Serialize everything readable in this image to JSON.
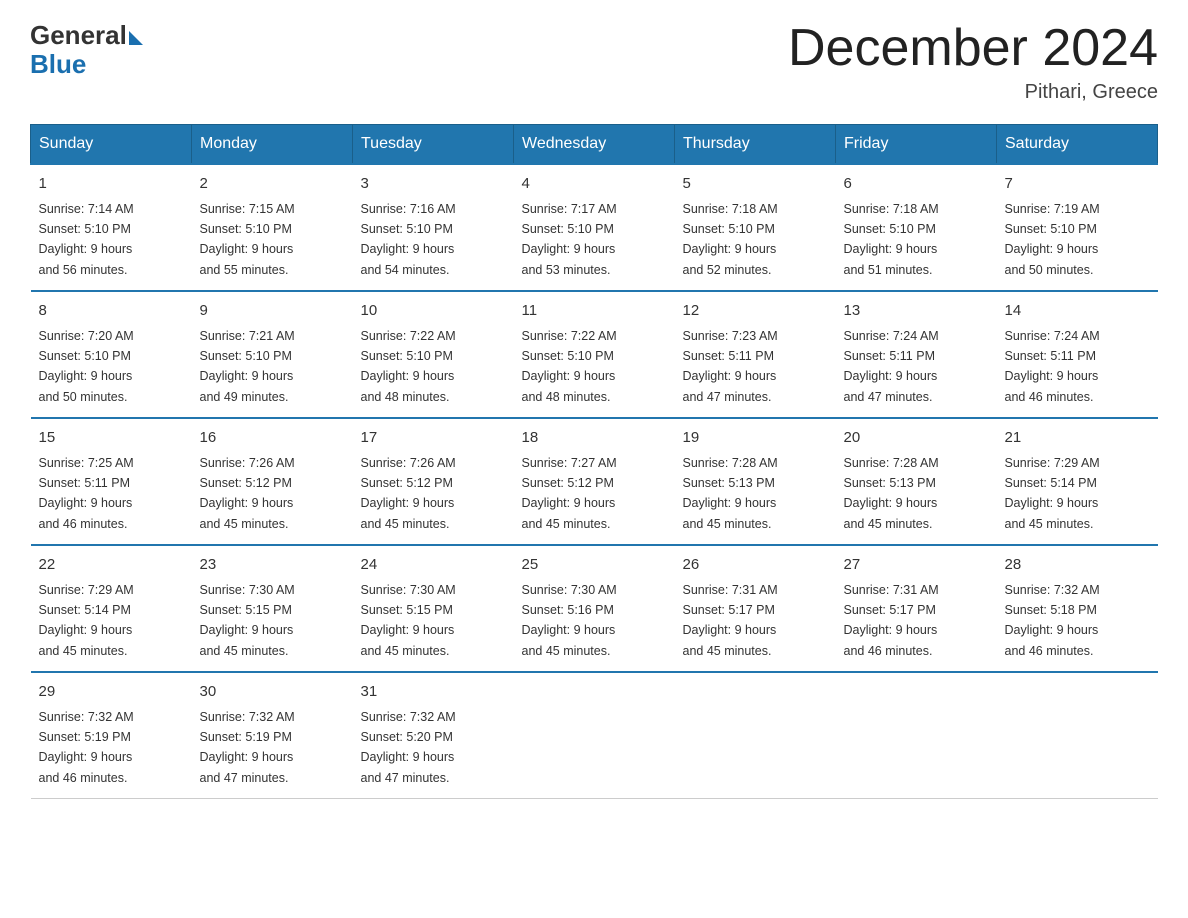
{
  "logo": {
    "general": "General",
    "blue": "Blue"
  },
  "header": {
    "title": "December 2024",
    "location": "Pithari, Greece"
  },
  "weekdays": [
    "Sunday",
    "Monday",
    "Tuesday",
    "Wednesday",
    "Thursday",
    "Friday",
    "Saturday"
  ],
  "weeks": [
    [
      {
        "day": "1",
        "sunrise": "7:14 AM",
        "sunset": "5:10 PM",
        "daylight": "9 hours and 56 minutes."
      },
      {
        "day": "2",
        "sunrise": "7:15 AM",
        "sunset": "5:10 PM",
        "daylight": "9 hours and 55 minutes."
      },
      {
        "day": "3",
        "sunrise": "7:16 AM",
        "sunset": "5:10 PM",
        "daylight": "9 hours and 54 minutes."
      },
      {
        "day": "4",
        "sunrise": "7:17 AM",
        "sunset": "5:10 PM",
        "daylight": "9 hours and 53 minutes."
      },
      {
        "day": "5",
        "sunrise": "7:18 AM",
        "sunset": "5:10 PM",
        "daylight": "9 hours and 52 minutes."
      },
      {
        "day": "6",
        "sunrise": "7:18 AM",
        "sunset": "5:10 PM",
        "daylight": "9 hours and 51 minutes."
      },
      {
        "day": "7",
        "sunrise": "7:19 AM",
        "sunset": "5:10 PM",
        "daylight": "9 hours and 50 minutes."
      }
    ],
    [
      {
        "day": "8",
        "sunrise": "7:20 AM",
        "sunset": "5:10 PM",
        "daylight": "9 hours and 50 minutes."
      },
      {
        "day": "9",
        "sunrise": "7:21 AM",
        "sunset": "5:10 PM",
        "daylight": "9 hours and 49 minutes."
      },
      {
        "day": "10",
        "sunrise": "7:22 AM",
        "sunset": "5:10 PM",
        "daylight": "9 hours and 48 minutes."
      },
      {
        "day": "11",
        "sunrise": "7:22 AM",
        "sunset": "5:10 PM",
        "daylight": "9 hours and 48 minutes."
      },
      {
        "day": "12",
        "sunrise": "7:23 AM",
        "sunset": "5:11 PM",
        "daylight": "9 hours and 47 minutes."
      },
      {
        "day": "13",
        "sunrise": "7:24 AM",
        "sunset": "5:11 PM",
        "daylight": "9 hours and 47 minutes."
      },
      {
        "day": "14",
        "sunrise": "7:24 AM",
        "sunset": "5:11 PM",
        "daylight": "9 hours and 46 minutes."
      }
    ],
    [
      {
        "day": "15",
        "sunrise": "7:25 AM",
        "sunset": "5:11 PM",
        "daylight": "9 hours and 46 minutes."
      },
      {
        "day": "16",
        "sunrise": "7:26 AM",
        "sunset": "5:12 PM",
        "daylight": "9 hours and 45 minutes."
      },
      {
        "day": "17",
        "sunrise": "7:26 AM",
        "sunset": "5:12 PM",
        "daylight": "9 hours and 45 minutes."
      },
      {
        "day": "18",
        "sunrise": "7:27 AM",
        "sunset": "5:12 PM",
        "daylight": "9 hours and 45 minutes."
      },
      {
        "day": "19",
        "sunrise": "7:28 AM",
        "sunset": "5:13 PM",
        "daylight": "9 hours and 45 minutes."
      },
      {
        "day": "20",
        "sunrise": "7:28 AM",
        "sunset": "5:13 PM",
        "daylight": "9 hours and 45 minutes."
      },
      {
        "day": "21",
        "sunrise": "7:29 AM",
        "sunset": "5:14 PM",
        "daylight": "9 hours and 45 minutes."
      }
    ],
    [
      {
        "day": "22",
        "sunrise": "7:29 AM",
        "sunset": "5:14 PM",
        "daylight": "9 hours and 45 minutes."
      },
      {
        "day": "23",
        "sunrise": "7:30 AM",
        "sunset": "5:15 PM",
        "daylight": "9 hours and 45 minutes."
      },
      {
        "day": "24",
        "sunrise": "7:30 AM",
        "sunset": "5:15 PM",
        "daylight": "9 hours and 45 minutes."
      },
      {
        "day": "25",
        "sunrise": "7:30 AM",
        "sunset": "5:16 PM",
        "daylight": "9 hours and 45 minutes."
      },
      {
        "day": "26",
        "sunrise": "7:31 AM",
        "sunset": "5:17 PM",
        "daylight": "9 hours and 45 minutes."
      },
      {
        "day": "27",
        "sunrise": "7:31 AM",
        "sunset": "5:17 PM",
        "daylight": "9 hours and 46 minutes."
      },
      {
        "day": "28",
        "sunrise": "7:32 AM",
        "sunset": "5:18 PM",
        "daylight": "9 hours and 46 minutes."
      }
    ],
    [
      {
        "day": "29",
        "sunrise": "7:32 AM",
        "sunset": "5:19 PM",
        "daylight": "9 hours and 46 minutes."
      },
      {
        "day": "30",
        "sunrise": "7:32 AM",
        "sunset": "5:19 PM",
        "daylight": "9 hours and 47 minutes."
      },
      {
        "day": "31",
        "sunrise": "7:32 AM",
        "sunset": "5:20 PM",
        "daylight": "9 hours and 47 minutes."
      },
      null,
      null,
      null,
      null
    ]
  ],
  "labels": {
    "sunrise": "Sunrise:",
    "sunset": "Sunset:",
    "daylight": "Daylight:"
  }
}
